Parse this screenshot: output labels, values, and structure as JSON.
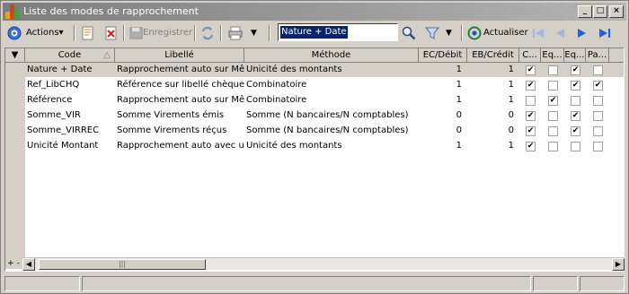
{
  "window": {
    "title": "Liste des modes de rapprochement",
    "controls": {
      "minimize": "_",
      "maximize": "□",
      "close": "×"
    }
  },
  "toolbar": {
    "actions_label": "Actions",
    "save_label": "Enregistrer",
    "search_value": "Nature + Date",
    "refresh_label": "Actualiser"
  },
  "table": {
    "headers": {
      "code": "Code",
      "libelle": "Libellé",
      "methode": "Méthode",
      "ec_debit": "EC/Débit",
      "eb_credit": "EB/Crédit",
      "c": "C...",
      "eq1": "Eq...",
      "eq2": "Eq...",
      "pa": "Pa..."
    },
    "rows": [
      {
        "code": "Nature + Date",
        "libelle": "Rapprochement auto sur Mêr",
        "methode": "Unicité des montants",
        "ec": "1",
        "eb": "1",
        "c": true,
        "eq1": false,
        "eq2": true,
        "pa": false,
        "selected": true
      },
      {
        "code": "Ref_LibCHQ",
        "libelle": "Référence sur libellé chèque",
        "methode": "Combinatoire",
        "ec": "1",
        "eb": "1",
        "c": true,
        "eq1": false,
        "eq2": true,
        "pa": true
      },
      {
        "code": "Référence",
        "libelle": "Rapprochement auto sur Mêr",
        "methode": "Combinatoire",
        "ec": "1",
        "eb": "1",
        "c": false,
        "eq1": true,
        "eq2": false,
        "pa": false
      },
      {
        "code": "Somme_VIR",
        "libelle": "Somme Virements émis",
        "methode": "Somme (N bancaires/N comptables)",
        "ec": "0",
        "eb": "0",
        "c": true,
        "eq1": false,
        "eq2": true,
        "pa": false
      },
      {
        "code": "Somme_VIRREC",
        "libelle": "Somme Virements réçus",
        "methode": "Somme (N bancaires/N comptables)",
        "ec": "0",
        "eb": "0",
        "c": true,
        "eq1": false,
        "eq2": true,
        "pa": false
      },
      {
        "code": "Unicité Montant",
        "libelle": "Rapprochement auto avec ur",
        "methode": "Unicité des montants",
        "ec": "1",
        "eb": "1",
        "c": true,
        "eq1": false,
        "eq2": false,
        "pa": false
      }
    ]
  },
  "footer": {
    "plus_minus": "+ -"
  }
}
